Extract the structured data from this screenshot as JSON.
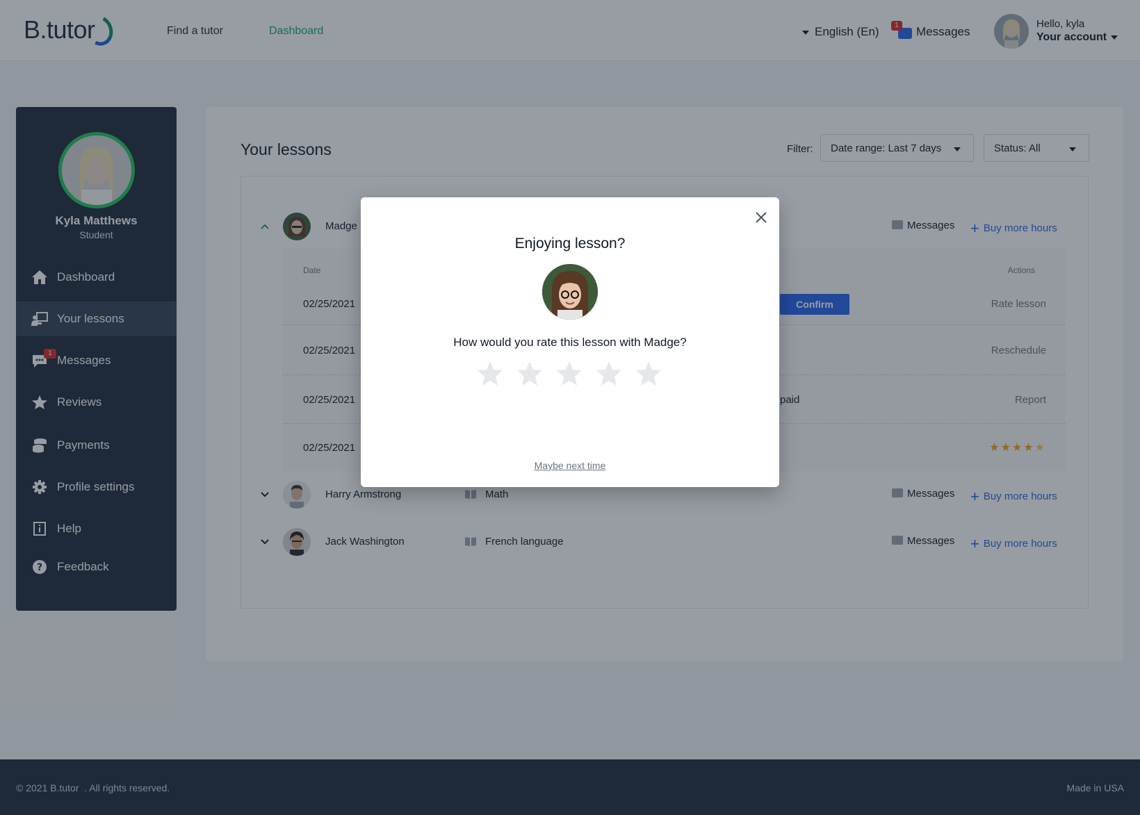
{
  "header": {
    "logo": "B.tutor",
    "nav": [
      {
        "label": "Find a tutor",
        "active": false
      },
      {
        "label": "Dashboard",
        "active": true
      }
    ],
    "language": "English (En)",
    "messages_label": "Messages",
    "messages_badge": "1",
    "hello": "Hello,  kyla",
    "account": "Your account"
  },
  "sidebar": {
    "name": "Kyla Matthews",
    "role": "Student",
    "items": [
      {
        "label": "Dashboard",
        "icon": "home-icon"
      },
      {
        "label": "Your lessons",
        "icon": "lessons-icon",
        "active": true
      },
      {
        "label": "Messages",
        "icon": "chat-icon",
        "badge": "1"
      },
      {
        "label": "Reviews",
        "icon": "star-icon"
      },
      {
        "label": "Payments",
        "icon": "coins-icon"
      },
      {
        "label": "Profile settings",
        "icon": "gear-icon"
      },
      {
        "label": "Help",
        "icon": "info-icon"
      },
      {
        "label": "Feedback",
        "icon": "question-icon"
      }
    ]
  },
  "main": {
    "title": "Your lessons",
    "filter_label": "Filter:",
    "date_range": "Date range: Last 7 days",
    "status": "Status: All",
    "tutors": [
      {
        "name": "Madge P",
        "subject": "",
        "messages": "Messages",
        "buy": "Buy more hours",
        "expanded": true
      },
      {
        "name": "Harry Armstrong",
        "subject": "Math",
        "messages": "Messages",
        "buy": "Buy more hours",
        "expanded": false
      },
      {
        "name": "Jack Washington",
        "subject": "French language",
        "messages": "Messages",
        "buy": "Buy more hours",
        "expanded": false
      }
    ],
    "table": {
      "col_date": "Date",
      "col_actions": "Actions",
      "rows": [
        {
          "date": "02/25/2021",
          "action": "Rate lesson",
          "button": "Confirm"
        },
        {
          "date": "02/25/2021",
          "action": "Reschedule"
        },
        {
          "date": "02/25/2021",
          "action": "Report",
          "status": "paid"
        },
        {
          "date": "02/25/2021",
          "rating": 4.5
        }
      ]
    }
  },
  "footer": {
    "copyright": "© 2021 B.tutor  . All rights reserved.",
    "made_in": "Made in USA"
  },
  "modal": {
    "title": "Enjoying lesson?",
    "question": "How would you rate this lesson with Madge?",
    "rating_max": 5,
    "rating_value": 0,
    "skip": "Maybe next time"
  }
}
